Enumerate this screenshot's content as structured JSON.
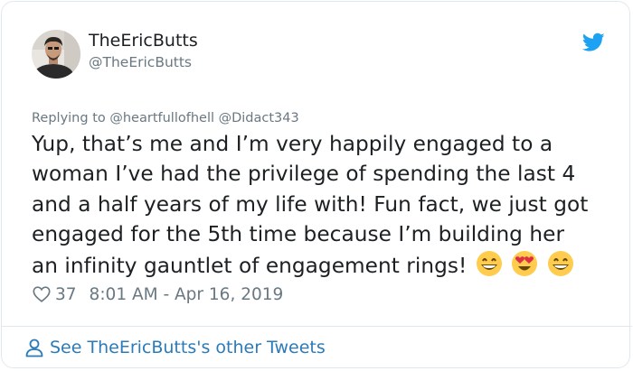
{
  "tweet": {
    "display_name": "TheEricButts",
    "handle": "@TheEricButts",
    "replying": {
      "prefix": "Replying to",
      "mentions": [
        "@heartfullofhell",
        "@Didact343"
      ]
    },
    "text_lines": [
      "Yup, that’s me and I’m very happily engaged to a",
      "woman I’ve had the privilege of spending the last 4",
      "and a half years of my life with! Fun fact, we just got",
      "engaged for the 5th time because I’m building her",
      "an infinity gauntlet of engagement rings!"
    ],
    "emojis": [
      "grinning-face-emoji",
      "heart-eyes-emoji",
      "grinning-face-emoji"
    ],
    "likes": "37",
    "timestamp": "8:01 AM - Apr 16, 2019"
  },
  "footer": {
    "link_text": "See TheEricButts's other Tweets"
  },
  "colors": {
    "link_blue": "#2b7bb9",
    "twitter_blue": "#1da1f2",
    "muted_gray": "#697882",
    "text": "#1c2022",
    "border": "#e1e8ed"
  },
  "icons": {
    "platform": "twitter-bird-icon",
    "like": "heart-outline-icon",
    "profile": "person-outline-icon"
  }
}
